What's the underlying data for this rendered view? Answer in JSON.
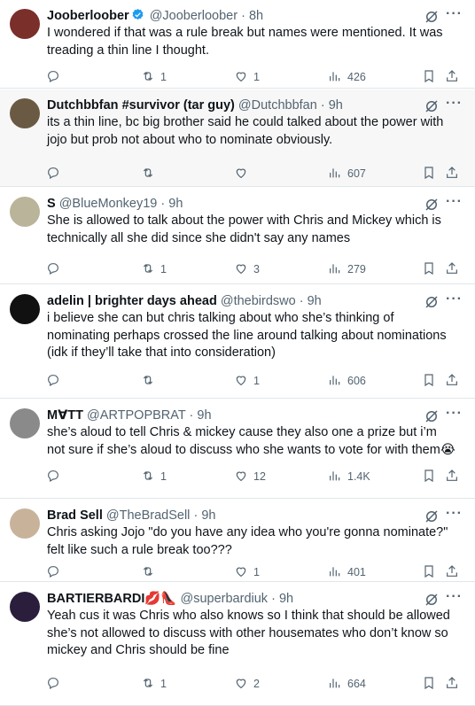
{
  "tweets": [
    {
      "name": "Jooberloober",
      "handle": "@Jooberloober",
      "time": "8h",
      "verified": true,
      "text": "I wondered if that was a rule break but names were mentioned. It was treading a thin line I thought.",
      "replies": "",
      "retweets": "1",
      "likes": "1",
      "views": "426",
      "avatar_color": "#7a2f2a"
    },
    {
      "name": "Dutchbbfan #survivor (tar guy)",
      "handle": "@Dutchbbfan",
      "time": "9h",
      "verified": false,
      "text": "its a thin line, bc big brother said he could talked about the power with jojo but prob not about who to nominate obviously.",
      "replies": "",
      "retweets": "",
      "likes": "",
      "views": "607",
      "avatar_color": "#6b5a43"
    },
    {
      "name": "S",
      "handle": "@BlueMonkey19",
      "time": "9h",
      "verified": false,
      "text": "She is allowed to talk about the power with Chris and Mickey which is technically all she did since she didn't say any names",
      "replies": "",
      "retweets": "1",
      "likes": "3",
      "views": "279",
      "avatar_color": "#b9b49a"
    },
    {
      "name": "adelin | brighter days ahead",
      "handle": "@thebirdswo",
      "time": "9h",
      "verified": false,
      "text": "i believe she can but chris talking about who she’s thinking of nominating perhaps crossed the line around talking about nominations (idk if they’ll take that into consideration)",
      "replies": "",
      "retweets": "",
      "likes": "1",
      "views": "606",
      "avatar_color": "#111111"
    },
    {
      "name": "M∀TT",
      "handle": "@ARTPOPBRAT",
      "time": "9h",
      "verified": false,
      "text": "she’s aloud to tell Chris & mickey cause they also one a prize but i’m not sure if she’s aloud to discuss who she wants to vote for with them😭",
      "replies": "",
      "retweets": "1",
      "likes": "12",
      "views": "1.4K",
      "avatar_color": "#8a8a8a"
    },
    {
      "name": "Brad Sell",
      "handle": "@TheBradSell",
      "time": "9h",
      "verified": false,
      "text": "Chris asking Jojo \"do you have any idea who you're gonna nominate?\" felt like such a rule break too???",
      "replies": "",
      "retweets": "",
      "likes": "1",
      "views": "401",
      "avatar_color": "#c8b39a"
    },
    {
      "name": "BARTIERBARDI💋👠",
      "handle": "@superbardiuk",
      "time": "9h",
      "verified": false,
      "text": "Yeah cus it was Chris who also knows so I think that should be allowed she’s not allowed to discuss with other housemates who don’t know so mickey and Chris should be fine",
      "replies": "",
      "retweets": "1",
      "likes": "2",
      "views": "664",
      "avatar_color": "#2b1e3d"
    }
  ],
  "icons": {
    "reply": "reply-icon",
    "retweet": "retweet-icon",
    "like": "heart-icon",
    "views": "views-icon",
    "bookmark": "bookmark-icon",
    "share": "share-icon",
    "grok": "grok-icon",
    "more": "more-icon",
    "verified": "verified-badge-icon"
  },
  "colors": {
    "text": "#0f1419",
    "secondary": "#536471",
    "verified": "#1d9bf0",
    "divider": "#e1e6ea"
  },
  "more_label": "···"
}
